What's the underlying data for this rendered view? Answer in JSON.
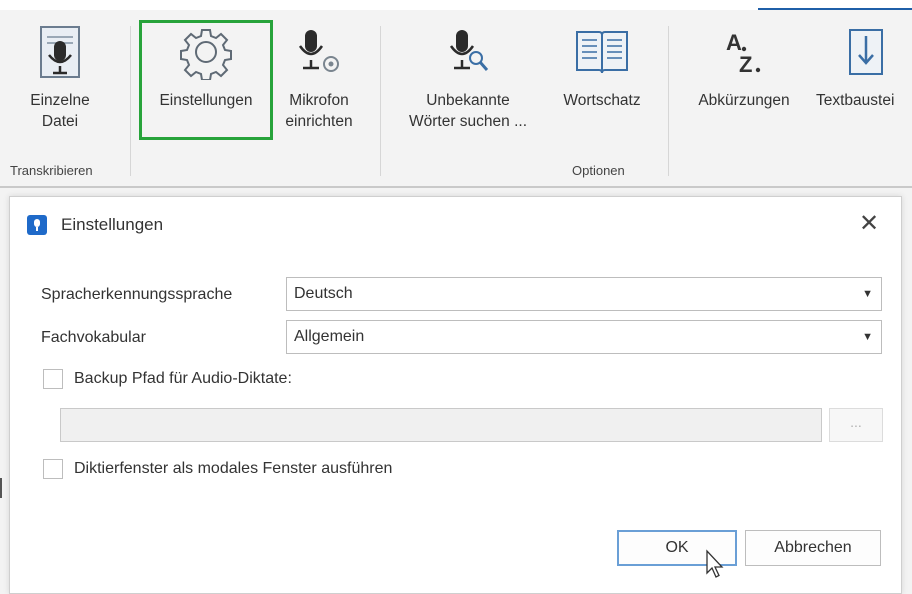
{
  "ribbon": {
    "buttons": [
      {
        "label": "Einzelne\nDatei",
        "icon": "microphone-file-icon"
      },
      {
        "label": "Einstellungen",
        "icon": "gear-icon"
      },
      {
        "label": "Mikrofon\neinrichten",
        "icon": "microphone-settings-icon"
      },
      {
        "label": "Unbekannte\nWörter suchen ...",
        "icon": "microphone-search-icon"
      },
      {
        "label": "Wortschatz",
        "icon": "book-icon"
      },
      {
        "label": "Abkürzungen",
        "icon": "az-abbreviation-icon"
      },
      {
        "label": "Textbaustei",
        "icon": "text-block-icon"
      }
    ],
    "groups": {
      "transcribe": "Transkribieren",
      "options": "Optionen"
    }
  },
  "dialog": {
    "title": "Einstellungen",
    "close_symbol": "✕",
    "fields": {
      "language_label": "Spracherkennungssprache",
      "language_value": "Deutsch",
      "vocab_label": "Fachvokabular",
      "vocab_value": "Allgemein",
      "backup_label": "Backup Pfad für Audio-Diktate:",
      "backup_checked": false,
      "path_value": "",
      "browse_label": "...",
      "modal_label": "Diktierfenster als modales Fenster ausführen",
      "modal_checked": false
    },
    "buttons": {
      "ok": "OK",
      "cancel": "Abbrechen"
    }
  },
  "colors": {
    "selection_outline": "#27a33a",
    "app_icon": "#1f6ac9",
    "ok_focus": "#6a9fd6"
  }
}
